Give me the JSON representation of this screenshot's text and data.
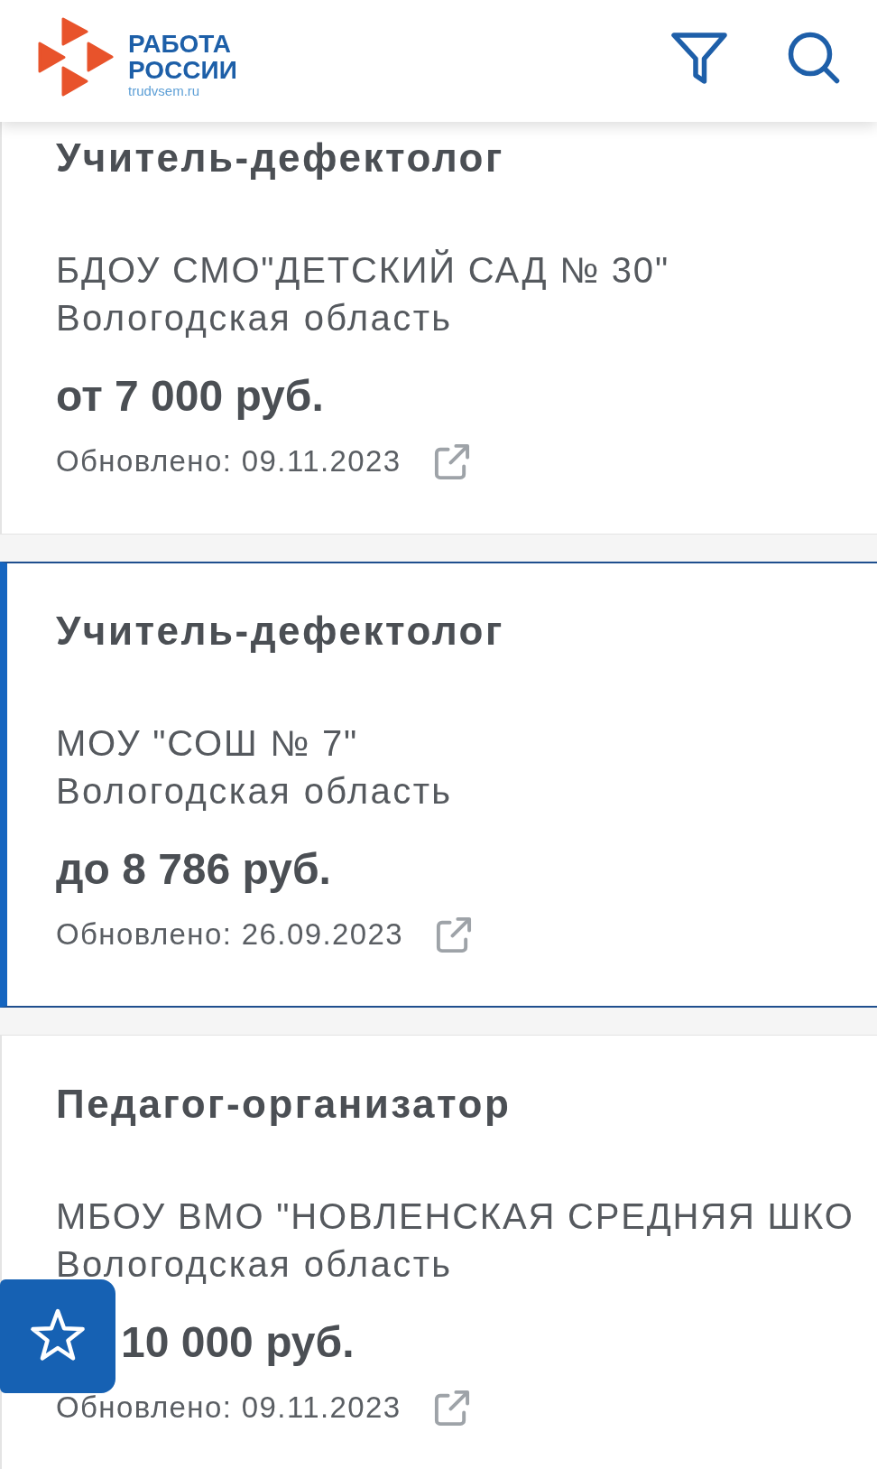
{
  "header": {
    "logo": {
      "wordmark": "РАБОТА\nРОССИИ",
      "domain": "trudvsem.ru"
    }
  },
  "vacancies": [
    {
      "title": "Учитель-дефектолог",
      "employer": "БДОУ СМО\"ДЕТСКИЙ САД № 30\"",
      "region": "Вологодская область",
      "salary": "от 7 000 руб.",
      "updated": "Обновлено: 09.11.2023",
      "selected": false
    },
    {
      "title": "Учитель-дефектолог",
      "employer": "МОУ \"СОШ № 7\"",
      "region": "Вологодская область",
      "salary": "до 8 786 руб.",
      "updated": "Обновлено: 26.09.2023",
      "selected": true
    },
    {
      "title": "Педагог-организатор",
      "employer": "МБОУ ВМО \"НОВЛЕНСКАЯ СРЕДНЯЯ ШКО",
      "region": "Вологодская область",
      "salary": "10 000 руб.",
      "updated": "Обновлено: 09.11.2023",
      "selected": false
    }
  ]
}
